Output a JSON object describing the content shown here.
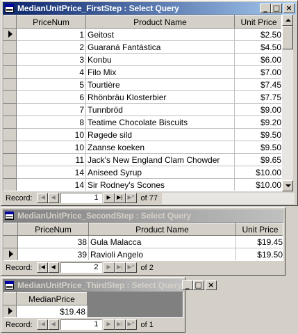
{
  "window1": {
    "title": "MedianUnitPrice_FirstStep : Select Query",
    "columns": [
      "PriceNum",
      "Product Name",
      "Unit Price"
    ],
    "rows": [
      {
        "num": "1",
        "name": "Geitost",
        "price": "$2.50"
      },
      {
        "num": "2",
        "name": "Guaraná Fantástica",
        "price": "$4.50"
      },
      {
        "num": "3",
        "name": "Konbu",
        "price": "$6.00"
      },
      {
        "num": "4",
        "name": "Filo Mix",
        "price": "$7.00"
      },
      {
        "num": "5",
        "name": "Tourtière",
        "price": "$7.45"
      },
      {
        "num": "6",
        "name": "Rhönbräu Klosterbier",
        "price": "$7.75"
      },
      {
        "num": "7",
        "name": "Tunnbröd",
        "price": "$9.00"
      },
      {
        "num": "8",
        "name": "Teatime Chocolate Biscuits",
        "price": "$9.20"
      },
      {
        "num": "10",
        "name": "Røgede sild",
        "price": "$9.50"
      },
      {
        "num": "10",
        "name": "Zaanse koeken",
        "price": "$9.50"
      },
      {
        "num": "11",
        "name": "Jack's New England Clam Chowder",
        "price": "$9.65"
      },
      {
        "num": "14",
        "name": "Aniseed Syrup",
        "price": "$10.00"
      },
      {
        "num": "14",
        "name": "Sir Rodney's Scones",
        "price": "$10.00"
      }
    ],
    "nav": {
      "label": "Record:",
      "current": "1",
      "of": "of  77"
    }
  },
  "window2": {
    "title": "MedianUnitPrice_SecondStep : Select Query",
    "columns": [
      "PriceNum",
      "Product Name",
      "Unit Price"
    ],
    "rows": [
      {
        "num": "38",
        "name": "Gula Malacca",
        "price": "$19.45"
      },
      {
        "num": "39",
        "name": "Ravioli Angelo",
        "price": "$19.50"
      }
    ],
    "nav": {
      "label": "Record:",
      "current": "2",
      "of": "of  2"
    }
  },
  "window3": {
    "title": "MedianUnitPrice_ThirdStep : Select Query",
    "columns": [
      "MedianPrice"
    ],
    "rows": [
      {
        "value": "$19.48"
      }
    ],
    "nav": {
      "label": "Record:",
      "current": "1",
      "of": "of  1"
    }
  },
  "controls": {
    "minimize": "_",
    "restore": "□",
    "close": "×"
  },
  "nav_glyphs": {
    "first": "|◀",
    "prev": "◀",
    "next": "▶",
    "last": "▶|",
    "new": "▶*"
  }
}
